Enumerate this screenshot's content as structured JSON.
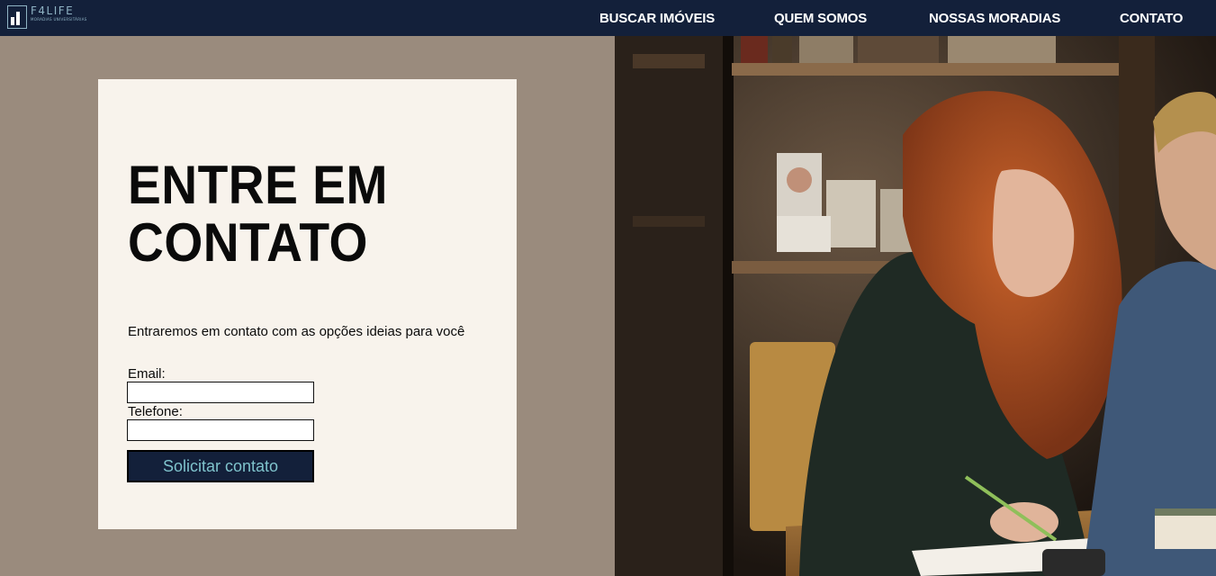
{
  "brand": {
    "name": "F4LIFE",
    "tagline": "MORADIAS UNIVERSITÁRIAS"
  },
  "nav": {
    "items": [
      {
        "label": "BUSCAR IMÓVEIS"
      },
      {
        "label": "QUEM SOMOS"
      },
      {
        "label": "NOSSAS MORADIAS"
      },
      {
        "label": "CONTATO"
      }
    ]
  },
  "contact": {
    "heading_line1": "ENTRE EM",
    "heading_line2": "CONTATO",
    "intro": "Entraremos em contato com as opções ideias para você",
    "email_label": "Email:",
    "email_value": "",
    "phone_label": "Telefone:",
    "phone_value": "",
    "submit_label": "Solicitar contato"
  },
  "hero_image": {
    "icon": "students-studying-photo"
  },
  "colors": {
    "navbar": "#13203a",
    "page_bg": "#9a8b7d",
    "card_bg": "#f8f3ec",
    "button_text": "#7fc3cc"
  }
}
